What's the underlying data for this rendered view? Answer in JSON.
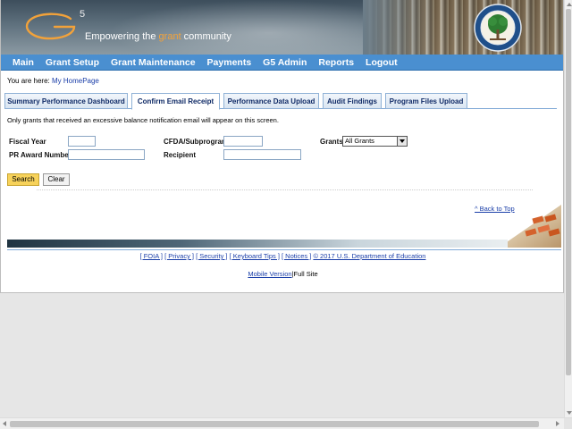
{
  "header": {
    "logo_letter": "G",
    "logo_superscript": "5",
    "tagline_before": "Empowering the ",
    "tagline_highlight": "grant",
    "tagline_after": " community"
  },
  "nav": {
    "items": [
      "Main",
      "Grant Setup",
      "Grant Maintenance",
      "Payments",
      "G5 Admin",
      "Reports",
      "Logout"
    ]
  },
  "breadcrumb": {
    "prefix": "You are here: ",
    "link": "My HomePage"
  },
  "tabs": [
    {
      "label": "Summary Performance Dashboard",
      "active": false
    },
    {
      "label": "Confirm Email Receipt",
      "active": true
    },
    {
      "label": "Performance Data Upload",
      "active": false
    },
    {
      "label": "Audit Findings",
      "active": false
    },
    {
      "label": "Program Files Upload",
      "active": false
    }
  ],
  "info_text": "Only grants that received an excessive balance notification email will appear on this screen.",
  "form": {
    "fiscal_year_label": "Fiscal Year",
    "fiscal_year_value": "",
    "cfda_label": "CFDA/Subprogram",
    "cfda_value": "",
    "grants_label": "Grants",
    "grants_selected": "All Grants",
    "pr_award_label": "PR Award Number",
    "pr_award_value": "",
    "recipient_label": "Recipient",
    "recipient_value": ""
  },
  "buttons": {
    "search": "Search",
    "clear": "Clear"
  },
  "back_to_top": "^ Back to Top",
  "footer": {
    "links": [
      "[ FOIA ]",
      "[ Privacy ]",
      "[ Security ]",
      "[ Keyboard Tips ]",
      "[ Notices ]",
      "© 2017 U.S. Department of Education"
    ],
    "mobile_version": "Mobile Version",
    "full_site": "Full Site",
    "separator": "|"
  },
  "colors": {
    "nav_bg": "#4a8fd0",
    "accent_orange": "#f2a23a",
    "search_button": "#f7d25a",
    "link": "#1a3ea8"
  },
  "icons": {
    "seal": "department-of-education-seal-icon",
    "logo": "g5-logo-icon"
  }
}
